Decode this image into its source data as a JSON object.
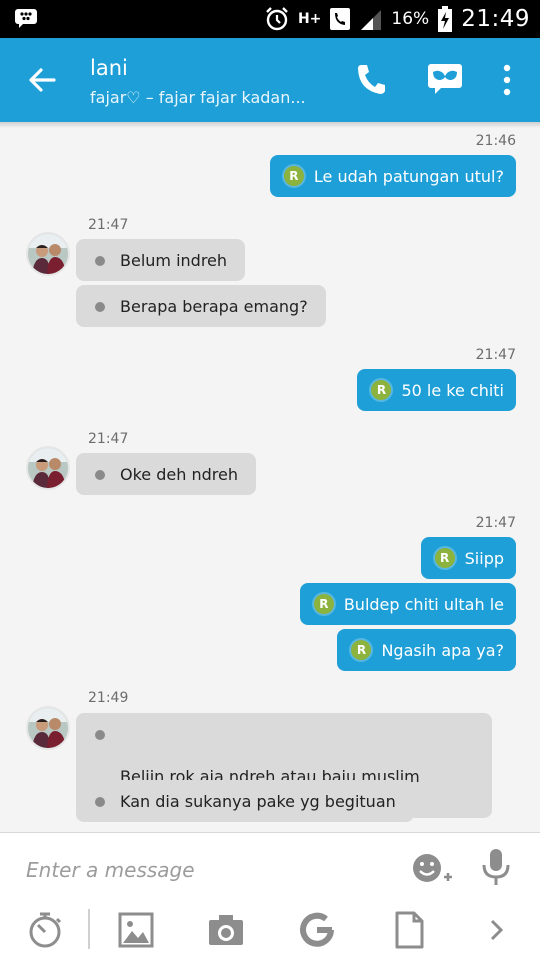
{
  "status_bar": {
    "network_label": "H+",
    "battery_percent": "16%",
    "time": "21:49"
  },
  "header": {
    "title": "lani",
    "subtitle": "fajar♡ – fajar fajar kadan..."
  },
  "conversation": {
    "group1": {
      "time": "21:46",
      "messages": [
        "Le udah patungan utul?"
      ]
    },
    "group2": {
      "time": "21:47",
      "messages": [
        "Belum indreh",
        "Berapa berapa emang?"
      ]
    },
    "group3": {
      "time": "21:47",
      "messages": [
        "50 le ke chiti"
      ]
    },
    "group4": {
      "time": "21:47",
      "messages": [
        "Oke deh ndreh"
      ]
    },
    "group5": {
      "time": "21:47",
      "messages": [
        "Siipp",
        "Buldep chiti ultah le",
        "Ngasih apa ya?"
      ]
    },
    "group6": {
      "time": "21:49",
      "messages": [
        "Beliin rok aja ndreh atau baju muslim\nterusan yg lagi hitz haha",
        "Kan dia sukanya pake yg begituan"
      ]
    },
    "read_badge": "R"
  },
  "compose": {
    "placeholder": "Enter a message",
    "value": ""
  },
  "icons": {
    "status_left": "bbm-notification-icon",
    "back": "arrow-left-icon",
    "call": "phone-icon",
    "mask": "mask-icon",
    "more": "more-vert-icon",
    "emoji": "emoji-add-icon",
    "mic": "mic-icon",
    "timer": "timer-icon",
    "image": "image-icon",
    "camera": "camera-icon",
    "gif": "google-icon",
    "file": "file-icon",
    "next": "chevron-right-icon"
  },
  "colors": {
    "accent": "#1e9fd7",
    "incoming_bubble": "#dadada",
    "read_badge": "#8db33f"
  }
}
